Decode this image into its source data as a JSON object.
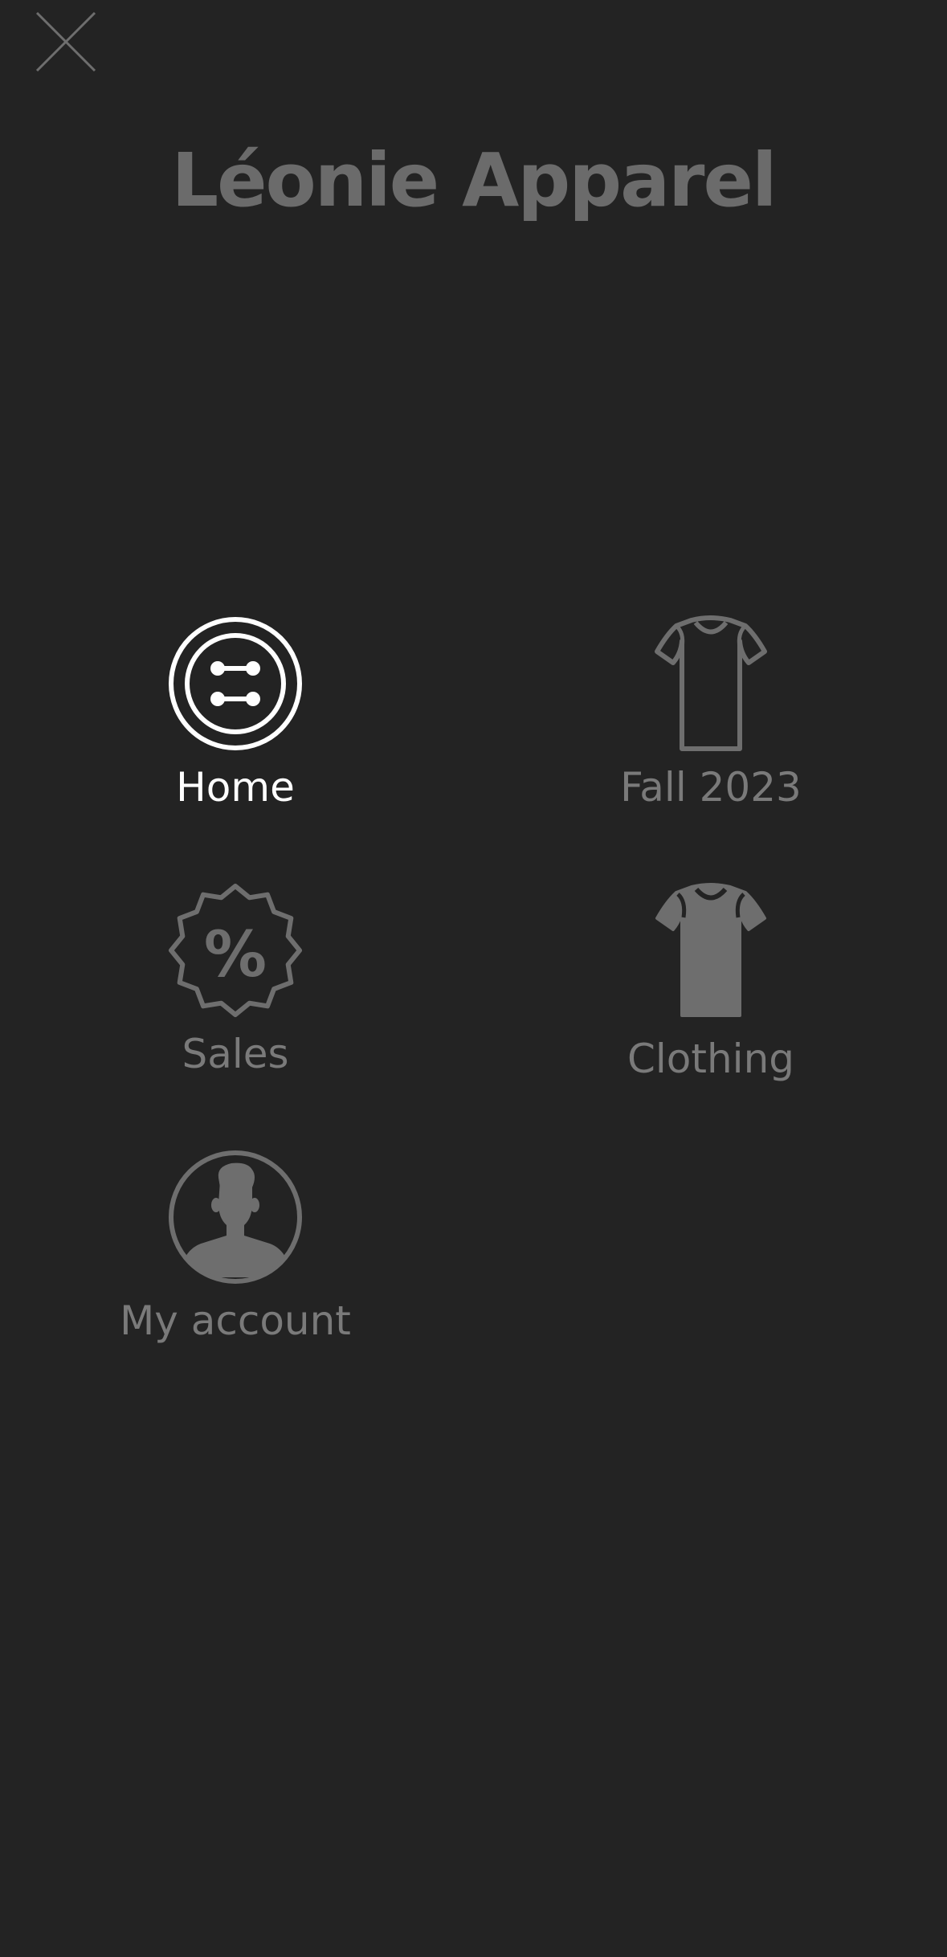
{
  "header": {
    "close_icon": "close-icon",
    "brand_name": "Léonie Apparel",
    "brand_color": "#6b6b6b"
  },
  "background_color": "#232323",
  "menu": {
    "items": [
      {
        "id": "home",
        "label": "Home",
        "icon": "button-icon",
        "active": true
      },
      {
        "id": "fall-2023",
        "label": "Fall 2023",
        "icon": "tshirt-outline-icon",
        "active": false
      },
      {
        "id": "sales",
        "label": "Sales",
        "icon": "percent-badge-icon",
        "active": false
      },
      {
        "id": "clothing",
        "label": "Clothing",
        "icon": "tshirt-filled-icon",
        "active": false
      },
      {
        "id": "my-account",
        "label": "My account",
        "icon": "user-avatar-icon",
        "active": false
      }
    ],
    "active_color": "#ffffff",
    "inactive_color": "#7a7a7a"
  }
}
